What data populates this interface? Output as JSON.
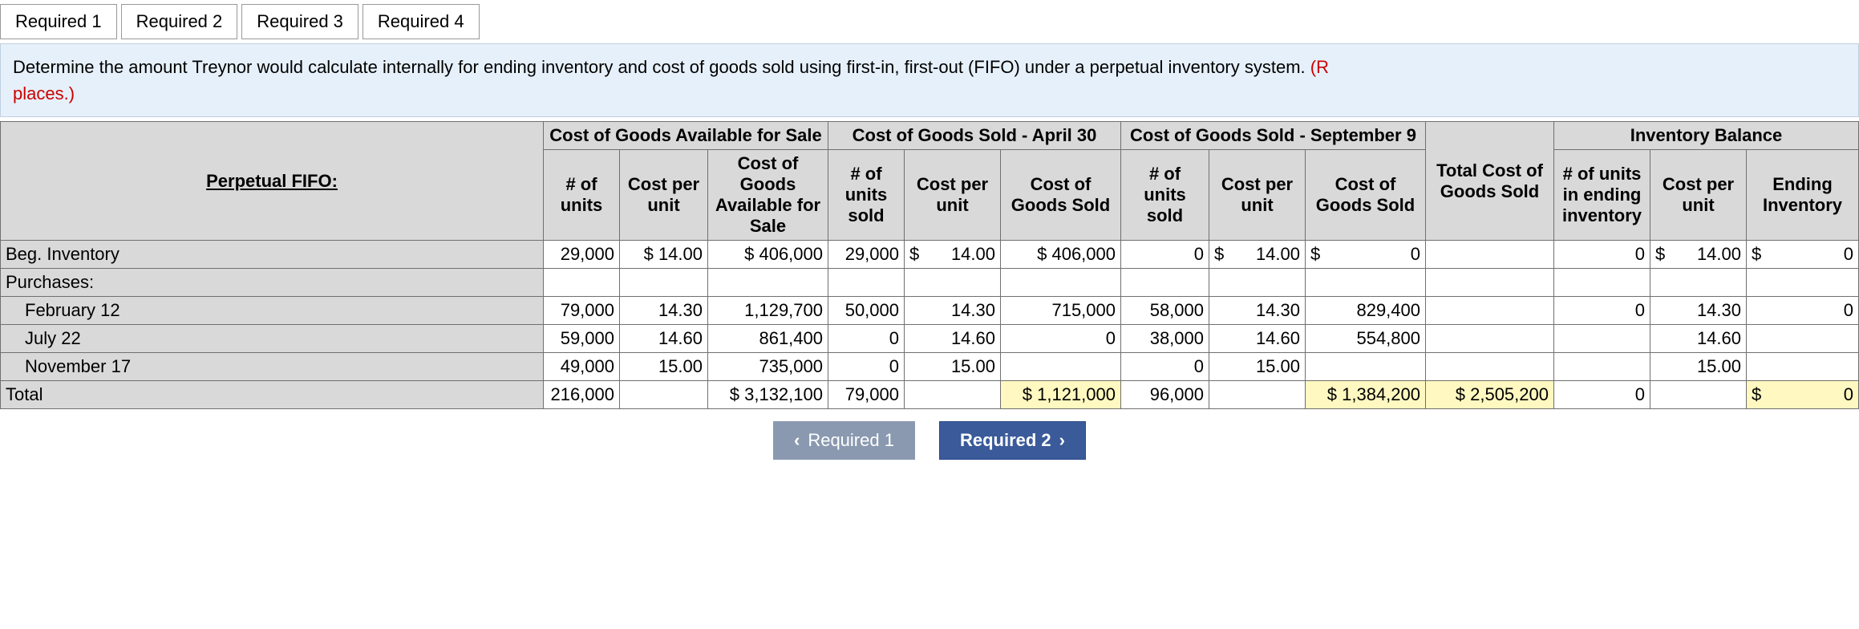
{
  "tabs": [
    "Required 1",
    "Required 2",
    "Required 3",
    "Required 4"
  ],
  "activeTab": 1,
  "instruction": {
    "text": "Determine the amount Treynor would calculate internally for ending inventory and cost of goods sold using first-in, first-out (FIFO) under a perpetual inventory system. ",
    "red": "(R",
    "red2": "places.)"
  },
  "groupHeaders": {
    "method": "Perpetual FIFO:",
    "avail": "Cost of Goods Available for Sale",
    "cogs1": "Cost of Goods Sold - April 30",
    "cogs2": "Cost of Goods Sold - September 9",
    "totalcogs": "Total Cost of Goods Sold",
    "inv": "Inventory Balance"
  },
  "colHeaders": {
    "avail": [
      "# of units",
      "Cost per unit",
      "Cost of Goods Available for Sale"
    ],
    "cogs1": [
      "# of units sold",
      "Cost per unit",
      "Cost of Goods Sold"
    ],
    "cogs2": [
      "# of units sold",
      "Cost per unit",
      "Cost of Goods Sold"
    ],
    "inv": [
      "# of units in ending inventory",
      "Cost per unit",
      "Ending Inventory"
    ]
  },
  "rows": [
    {
      "label": "Beg. Inventory",
      "indent": false,
      "avail": {
        "units": "29,000",
        "cpu": "$ 14.00",
        "total": "$    406,000"
      },
      "cogs1": {
        "units": "29,000",
        "cpu_pre": "$",
        "cpu": "14.00",
        "total": "$   406,000"
      },
      "cogs2": {
        "units": "0",
        "cpu_pre": "$",
        "cpu": "14.00",
        "total_pre": "$",
        "total": "0"
      },
      "totalcogs": "",
      "inv": {
        "units": "0",
        "cpu_pre": "$",
        "cpu": "14.00",
        "total_pre": "$",
        "total": "0"
      }
    },
    {
      "label": "Purchases:",
      "indent": false,
      "avail": {
        "units": "",
        "cpu": "",
        "total": ""
      },
      "cogs1": {
        "units": "",
        "cpu_pre": "",
        "cpu": "",
        "total": ""
      },
      "cogs2": {
        "units": "",
        "cpu_pre": "",
        "cpu": "",
        "total_pre": "",
        "total": ""
      },
      "totalcogs": "",
      "inv": {
        "units": "",
        "cpu_pre": "",
        "cpu": "",
        "total_pre": "",
        "total": ""
      }
    },
    {
      "label": "February 12",
      "indent": true,
      "avail": {
        "units": "79,000",
        "cpu": "14.30",
        "total": "1,129,700"
      },
      "cogs1": {
        "units": "50,000",
        "cpu_pre": "",
        "cpu": "14.30",
        "total": "715,000"
      },
      "cogs2": {
        "units": "58,000",
        "cpu_pre": "",
        "cpu": "14.30",
        "total_pre": "",
        "total": "829,400"
      },
      "totalcogs": "",
      "inv": {
        "units": "0",
        "cpu_pre": "",
        "cpu": "14.30",
        "total_pre": "",
        "total": "0"
      }
    },
    {
      "label": "July 22",
      "indent": true,
      "avail": {
        "units": "59,000",
        "cpu": "14.60",
        "total": "861,400"
      },
      "cogs1": {
        "units": "0",
        "cpu_pre": "",
        "cpu": "14.60",
        "total": "0"
      },
      "cogs2": {
        "units": "38,000",
        "cpu_pre": "",
        "cpu": "14.60",
        "total_pre": "",
        "total": "554,800"
      },
      "totalcogs": "",
      "inv": {
        "units": "",
        "cpu_pre": "",
        "cpu": "14.60",
        "total_pre": "",
        "total": ""
      }
    },
    {
      "label": "November 17",
      "indent": true,
      "avail": {
        "units": "49,000",
        "cpu": "15.00",
        "total": "735,000"
      },
      "cogs1": {
        "units": "0",
        "cpu_pre": "",
        "cpu": "15.00",
        "total": ""
      },
      "cogs2": {
        "units": "0",
        "cpu_pre": "",
        "cpu": "15.00",
        "total_pre": "",
        "total": ""
      },
      "totalcogs": "",
      "inv": {
        "units": "",
        "cpu_pre": "",
        "cpu": "15.00",
        "total_pre": "",
        "total": ""
      }
    },
    {
      "label": "Total",
      "indent": false,
      "avail": {
        "units": "216,000",
        "cpu": "",
        "total": "$ 3,132,100"
      },
      "cogs1": {
        "units": "79,000",
        "cpu_pre": "",
        "cpu": "",
        "total": "$ 1,121,000",
        "total_yellow": true
      },
      "cogs2": {
        "units": "96,000",
        "cpu_pre": "",
        "cpu": "",
        "total_pre": "",
        "total": "$ 1,384,200",
        "total_yellow": true
      },
      "totalcogs": "$    2,505,200",
      "totalcogs_yellow": true,
      "inv": {
        "units": "0",
        "cpu_pre": "",
        "cpu": "",
        "total_pre": "$",
        "total": "0",
        "total_yellow": true
      }
    }
  ],
  "nav": {
    "prev": "Required 1",
    "next": "Required 2"
  }
}
